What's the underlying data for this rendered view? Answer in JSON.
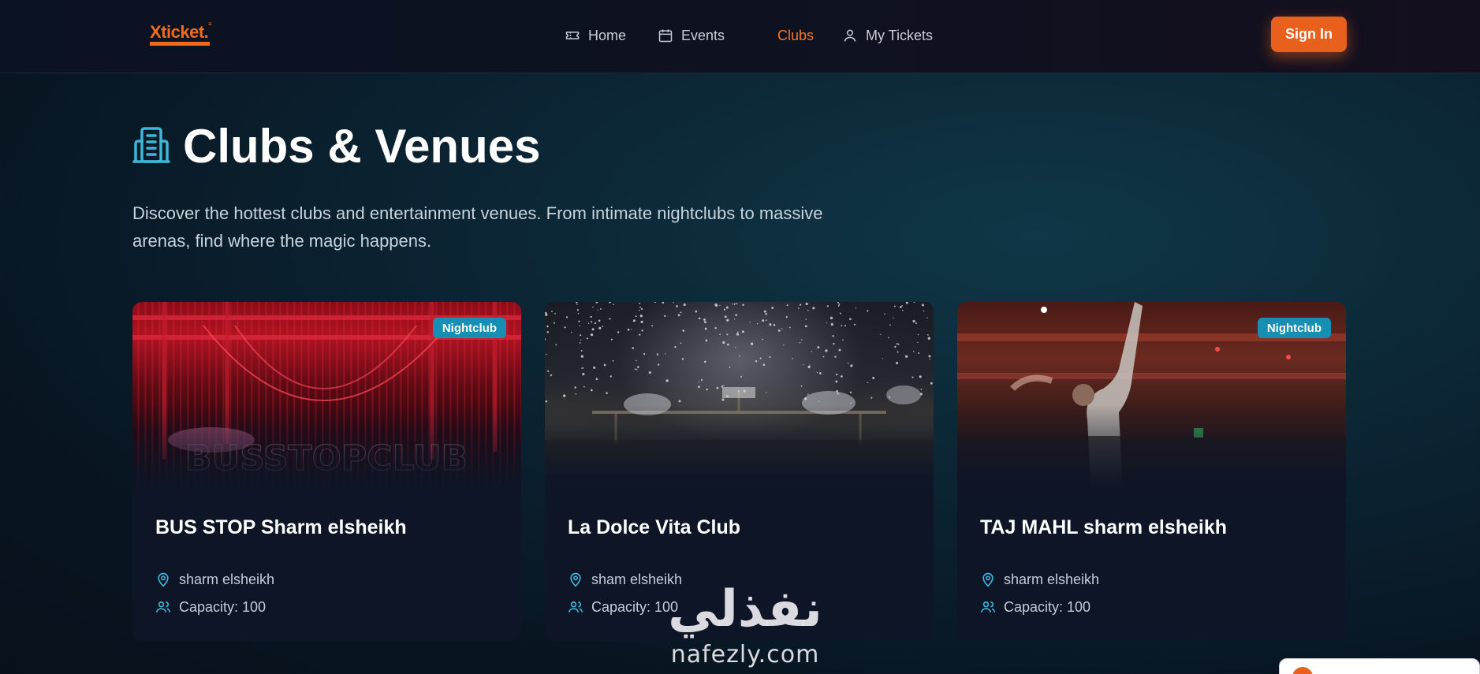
{
  "brand": {
    "logo_text": "Xticket.",
    "logo_mark": "≡"
  },
  "nav": {
    "items": [
      {
        "label": "Home",
        "icon": "ticket-icon"
      },
      {
        "label": "Events",
        "icon": "calendar-icon"
      },
      {
        "label": "Clubs",
        "icon": "building-icon",
        "active": true
      },
      {
        "label": "My Tickets",
        "icon": "user-icon"
      }
    ],
    "signin_label": "Sign In"
  },
  "hero": {
    "title": "Clubs & Venues",
    "subtitle": "Discover the hottest clubs and entertainment venues. From intimate nightclubs to massive arenas, find where the magic happens."
  },
  "clubs": [
    {
      "name": "BUS STOP Sharm elsheikh",
      "badge": "Nightclub",
      "location": "sharm elsheikh",
      "capacity": "Capacity: 100",
      "image_text": "BUSSTOPCLUB"
    },
    {
      "name": "La Dolce Vita Club",
      "badge": "",
      "location": "sham elsheikh",
      "capacity": "Capacity: 100",
      "image_text": ""
    },
    {
      "name": "TAJ MAHL sharm elsheikh",
      "badge": "Nightclub",
      "location": "sharm elsheikh",
      "capacity": "Capacity: 100",
      "image_text": ""
    }
  ],
  "watermark": {
    "arabic": "نفذلي",
    "latin": "nafezly.com"
  },
  "colors": {
    "accent": "#e8601c",
    "badge": "#1590b4",
    "card_bg": "#0e1526",
    "icon_teal": "#3fb6d8"
  }
}
